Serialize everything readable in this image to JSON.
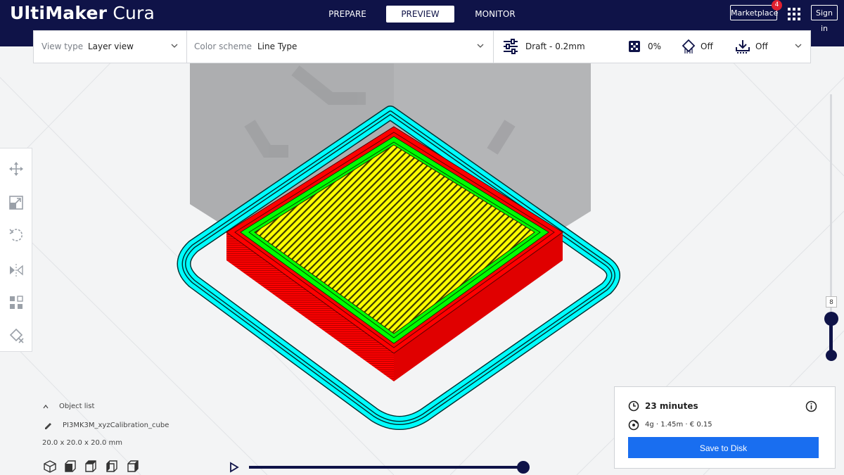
{
  "app": {
    "logo_bold": "UltiMaker",
    "logo_rest": " Cura"
  },
  "nav": {
    "tabs": [
      {
        "label": "PREPARE",
        "active": false
      },
      {
        "label": "PREVIEW",
        "active": true
      },
      {
        "label": "MONITOR",
        "active": false
      }
    ]
  },
  "header_right": {
    "marketplace_label": "Marketplace",
    "marketplace_badge": "4",
    "sign_in_label": "Sign in"
  },
  "toolbar": {
    "view_type_label": "View type",
    "view_type_value": "Layer view",
    "color_scheme_label": "Color scheme",
    "color_scheme_value": "Line Type",
    "profile": "Draft - 0.2mm",
    "infill": "0%",
    "support": "Off",
    "adhesion": "Off"
  },
  "icons": {
    "tools": [
      "move-icon",
      "scale-icon",
      "rotate-icon",
      "mirror-icon",
      "per-model-settings-icon",
      "support-blocker-icon"
    ],
    "views": [
      "3d-view-icon",
      "front-view-icon",
      "top-view-icon",
      "left-view-icon",
      "right-view-icon"
    ]
  },
  "object_list": {
    "label": "Object list",
    "name": "PI3MK3M_xyzCalibration_cube",
    "dimensions": "20.0 x 20.0 x 20.0 mm"
  },
  "layer_slider": {
    "current_layer": "8"
  },
  "playback": {
    "progress": 1.0
  },
  "print_info": {
    "time": "23 minutes",
    "material": "4g · 1.45m · € 0.15",
    "save_label": "Save to Disk"
  },
  "colors": {
    "header_bg": "#0f1348",
    "accent": "#196ef0",
    "skirt": "#00ffff",
    "wall_outer": "#ff0000",
    "wall_inner": "#00ff00",
    "top_bottom": "#ffff00"
  }
}
